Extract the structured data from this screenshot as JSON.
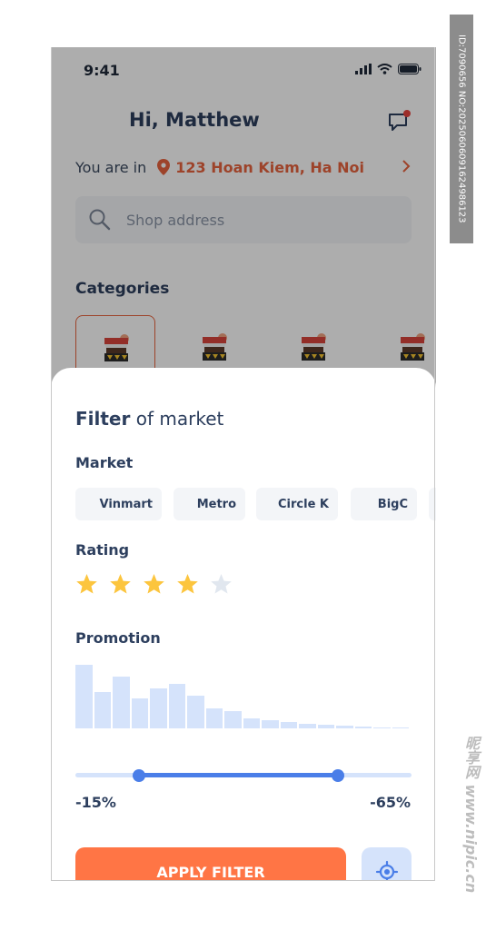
{
  "status_bar": {
    "time": "9:41"
  },
  "header": {
    "greeting": "Hi, Matthew"
  },
  "location": {
    "prefix": "You are in",
    "address": "123 Hoan Kiem, Ha Noi"
  },
  "search": {
    "placeholder": "Shop address"
  },
  "categories": {
    "title": "Categories",
    "count": 4,
    "selected_index": 0
  },
  "filter": {
    "title_bold": "Filter",
    "title_rest": " of market",
    "market_label": "Market",
    "markets": [
      "Vinmart",
      "Metro",
      "Circle K",
      "BigC"
    ],
    "rating_label": "Rating",
    "rating_value": 4,
    "rating_max": 5,
    "promotion_label": "Promotion",
    "promotion_distribution": [
      100,
      57,
      81,
      47,
      63,
      70,
      51,
      31,
      27,
      16,
      13,
      10,
      7,
      6,
      4,
      3,
      2,
      2
    ],
    "range_min_label": "-15%",
    "range_max_label": "-65%",
    "range_start_fraction": 0.19,
    "range_end_fraction": 0.78,
    "apply_label": "APPLY FILTER"
  },
  "colors": {
    "accent": "#ff7545",
    "primary_text": "#2d3f5e",
    "slider": "#4a7ee8",
    "slider_light": "#d5e3fb",
    "star_on": "#fcc53e",
    "star_off": "#e1e7ef"
  },
  "icons": {
    "signal": "signal-icon",
    "wifi": "wifi-icon",
    "battery": "battery-icon",
    "chat": "chat-icon",
    "pin": "location-pin-icon",
    "chevron": "chevron-right-icon",
    "search": "search-icon",
    "market_stall": "market-stall-icon",
    "locate": "locate-icon",
    "star": "star-icon"
  },
  "watermark": {
    "side_text": "ID:7090656 NO:20250606091624986123",
    "bottom_text": "昵享网 www.nipic.cn"
  }
}
